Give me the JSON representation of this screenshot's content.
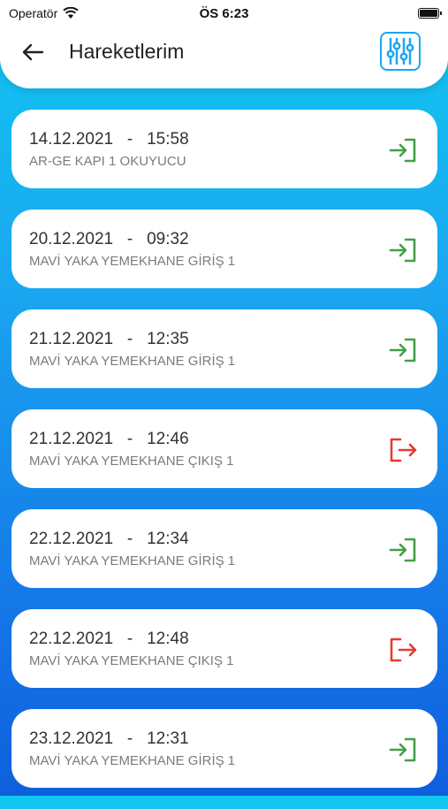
{
  "status_bar": {
    "carrier": "Operatör",
    "time": "ÖS 6:23"
  },
  "header": {
    "title": "Hareketlerim"
  },
  "colors": {
    "entry": "#43a047",
    "exit": "#e53935",
    "accent": "#1aa7f0"
  },
  "records": [
    {
      "date": "14.12.2021",
      "time": "15:58",
      "location": "AR-GE KAPI 1 OKUYUCU",
      "type": "entry",
      "icon": "login-icon"
    },
    {
      "date": "20.12.2021",
      "time": "09:32",
      "location": "MAVİ YAKA YEMEKHANE GİRİŞ 1",
      "type": "entry",
      "icon": "login-icon"
    },
    {
      "date": "21.12.2021",
      "time": "12:35",
      "location": "MAVİ YAKA YEMEKHANE GİRİŞ 1",
      "type": "entry",
      "icon": "login-icon"
    },
    {
      "date": "21.12.2021",
      "time": "12:46",
      "location": "MAVİ YAKA YEMEKHANE ÇIKIŞ 1",
      "type": "exit",
      "icon": "logout-icon"
    },
    {
      "date": "22.12.2021",
      "time": "12:34",
      "location": "MAVİ YAKA YEMEKHANE GİRİŞ 1",
      "type": "entry",
      "icon": "login-icon"
    },
    {
      "date": "22.12.2021",
      "time": "12:48",
      "location": "MAVİ YAKA YEMEKHANE ÇIKIŞ 1",
      "type": "exit",
      "icon": "logout-icon"
    },
    {
      "date": "23.12.2021",
      "time": "12:31",
      "location": "MAVİ YAKA YEMEKHANE GİRİŞ 1",
      "type": "entry",
      "icon": "login-icon"
    }
  ]
}
